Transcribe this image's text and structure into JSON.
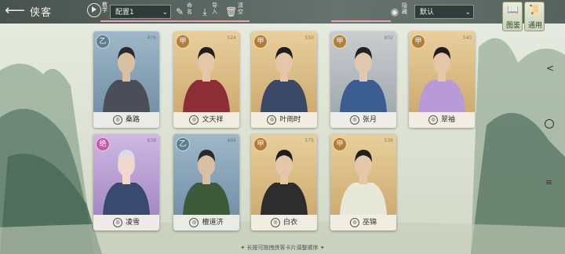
{
  "header": {
    "back_icon": "back-arrow-icon",
    "title": "侠客",
    "tutorial_label": "教学",
    "config_select": "配置1",
    "preset_label": "命名",
    "import_label": "导入",
    "clear_label": "清空",
    "eye_label": "隐藏",
    "sort_select": "默认",
    "book_label": "图鉴",
    "apply_label": "通用"
  },
  "cards": [
    {
      "name": "桑路",
      "grade": "乙",
      "stat": "476",
      "palette": "blue"
    },
    {
      "name": "文天祥",
      "grade": "甲",
      "stat": "524",
      "palette": "gold"
    },
    {
      "name": "叶雨时",
      "grade": "甲",
      "stat": "550",
      "palette": "gold"
    },
    {
      "name": "张月",
      "grade": "甲",
      "stat": "602",
      "palette": "grey"
    },
    {
      "name": "翠袖",
      "grade": "甲",
      "stat": "540",
      "palette": "gold"
    },
    {
      "name": "凌雪",
      "grade": "绝",
      "stat": "638",
      "palette": "purple"
    },
    {
      "name": "檀道济",
      "grade": "乙",
      "stat": "484",
      "palette": "blue"
    },
    {
      "name": "白衣",
      "grade": "甲",
      "stat": "575",
      "palette": "gold"
    },
    {
      "name": "巫锦",
      "grade": "甲",
      "stat": "536",
      "palette": "gold"
    }
  ],
  "footer": {
    "hint": "✦ 长按可拖拽侠客卡片调整顺序 ✦"
  },
  "colors": {
    "header_bg": "#3a4642",
    "pink_accent": "#e3a6b4"
  }
}
